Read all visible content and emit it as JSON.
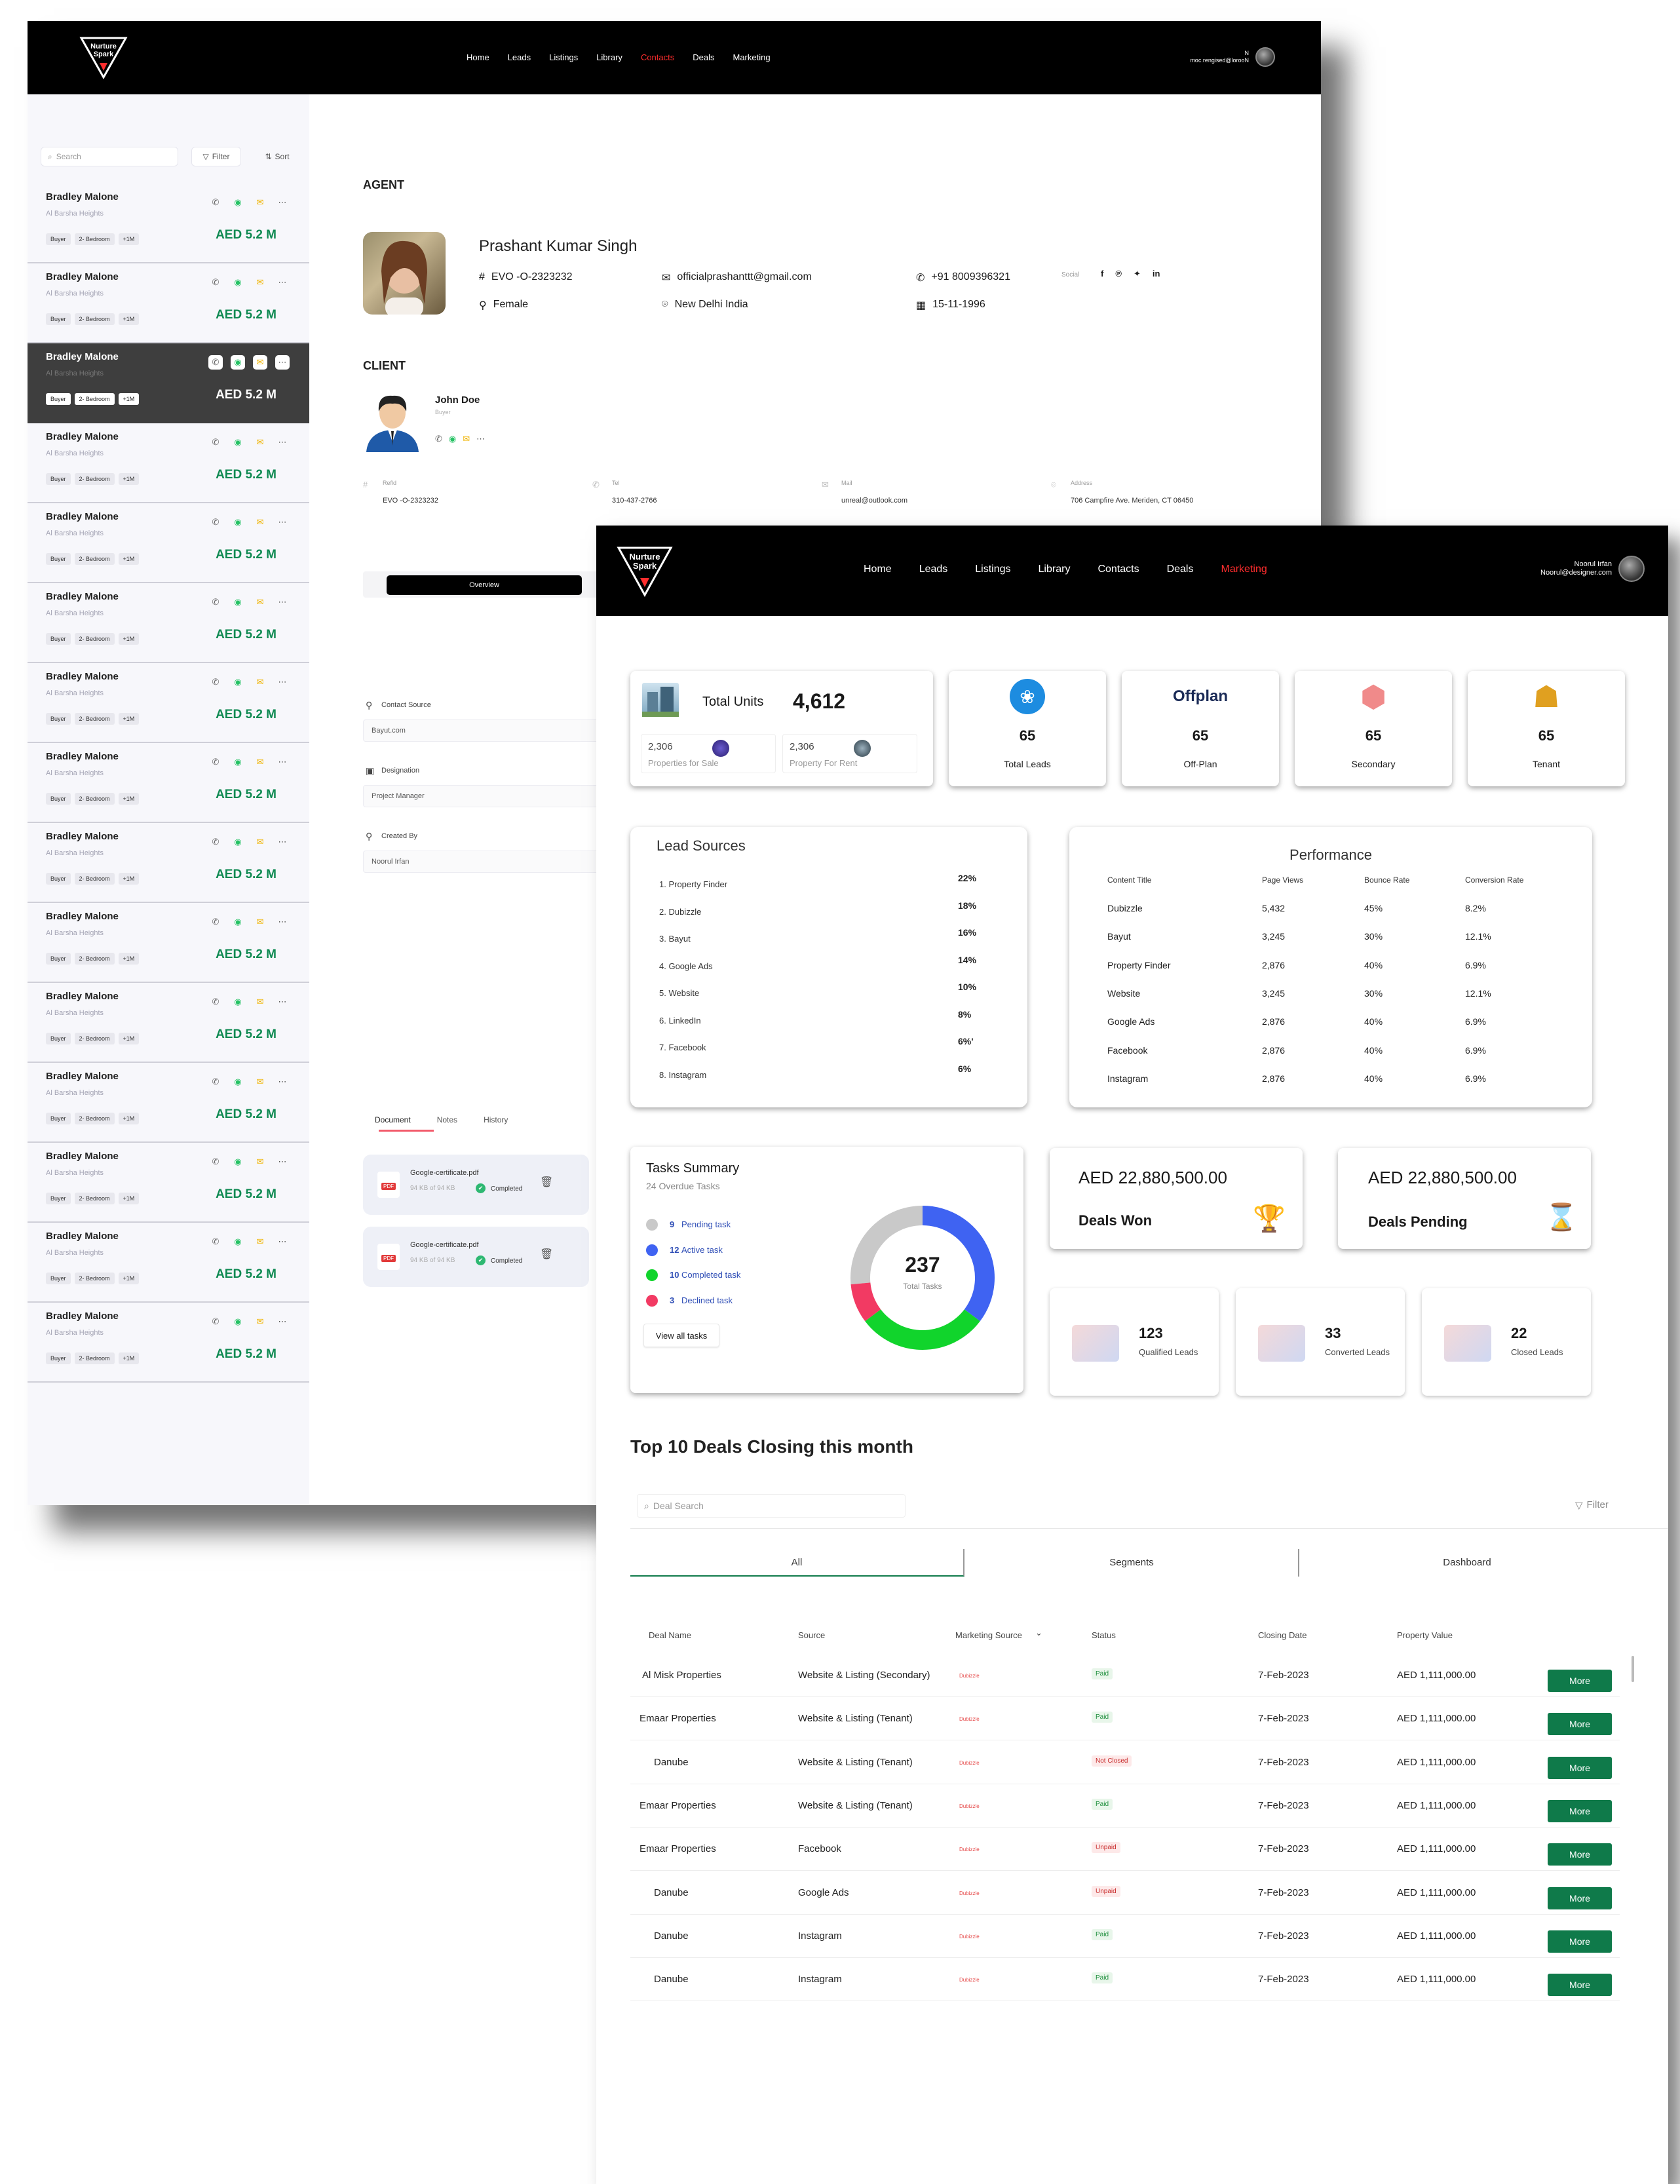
{
  "brand": {
    "name_line1": "Nurture",
    "name_line2": "Spark"
  },
  "win1": {
    "nav": [
      "Home",
      "Leads",
      "Listings",
      "Library",
      "Contacts",
      "Deals",
      "Marketing"
    ],
    "nav_active": "Contacts",
    "user": {
      "name": "N",
      "email": "moc.rengised@lorooN"
    },
    "sidebar": {
      "search_placeholder": "Search",
      "filter_label": "Filter",
      "sort_label": "Sort",
      "contacts": [
        {
          "name": "Bradley Malone",
          "location": "Al Barsha Heights",
          "tags": [
            "Buyer",
            "2- Bedroom",
            "+1M"
          ],
          "price": "AED 5.2 M"
        },
        {
          "name": "Bradley Malone",
          "location": "Al Barsha Heights",
          "tags": [
            "Buyer",
            "2- Bedroom",
            "+1M"
          ],
          "price": "AED 5.2 M"
        },
        {
          "name": "Bradley Malone",
          "location": "Al Barsha Heights",
          "tags": [
            "Buyer",
            "2- Bedroom",
            "+1M"
          ],
          "price": "AED 5.2 M"
        },
        {
          "name": "Bradley Malone",
          "location": "Al Barsha Heights",
          "tags": [
            "Buyer",
            "2- Bedroom",
            "+1M"
          ],
          "price": "AED 5.2 M"
        },
        {
          "name": "Bradley Malone",
          "location": "Al Barsha Heights",
          "tags": [
            "Buyer",
            "2- Bedroom",
            "+1M"
          ],
          "price": "AED 5.2 M"
        },
        {
          "name": "Bradley Malone",
          "location": "Al Barsha Heights",
          "tags": [
            "Buyer",
            "2- Bedroom",
            "+1M"
          ],
          "price": "AED 5.2 M"
        },
        {
          "name": "Bradley Malone",
          "location": "Al Barsha Heights",
          "tags": [
            "Buyer",
            "2- Bedroom",
            "+1M"
          ],
          "price": "AED 5.2 M"
        },
        {
          "name": "Bradley Malone",
          "location": "Al Barsha Heights",
          "tags": [
            "Buyer",
            "2- Bedroom",
            "+1M"
          ],
          "price": "AED 5.2 M"
        },
        {
          "name": "Bradley Malone",
          "location": "Al Barsha Heights",
          "tags": [
            "Buyer",
            "2- Bedroom",
            "+1M"
          ],
          "price": "AED 5.2 M"
        },
        {
          "name": "Bradley Malone",
          "location": "Al Barsha Heights",
          "tags": [
            "Buyer",
            "2- Bedroom",
            "+1M"
          ],
          "price": "AED 5.2 M"
        },
        {
          "name": "Bradley Malone",
          "location": "Al Barsha Heights",
          "tags": [
            "Buyer",
            "2- Bedroom",
            "+1M"
          ],
          "price": "AED 5.2 M"
        },
        {
          "name": "Bradley Malone",
          "location": "Al Barsha Heights",
          "tags": [
            "Buyer",
            "2- Bedroom",
            "+1M"
          ],
          "price": "AED 5.2 M"
        },
        {
          "name": "Bradley Malone",
          "location": "Al Barsha Heights",
          "tags": [
            "Buyer",
            "2- Bedroom",
            "+1M"
          ],
          "price": "AED 5.2 M"
        },
        {
          "name": "Bradley Malone",
          "location": "Al Barsha Heights",
          "tags": [
            "Buyer",
            "2- Bedroom",
            "+1M"
          ],
          "price": "AED 5.2 M"
        },
        {
          "name": "Bradley Malone",
          "location": "Al Barsha Heights",
          "tags": [
            "Buyer",
            "2- Bedroom",
            "+1M"
          ],
          "price": "AED 5.2 M"
        }
      ],
      "selected_index": 2
    },
    "agent": {
      "section_title": "AGENT",
      "name": "Prashant Kumar Singh",
      "id": "EVO -O-2323232",
      "gender": "Female",
      "email": "officialprashanttt@gmail.com",
      "location": "New Delhi India",
      "phone": "+91 8009396321",
      "dob": "15-11-1996",
      "social_label": "Social",
      "social_icons": [
        "facebook-icon",
        "pinterest-icon",
        "twitter-icon",
        "linkedin-icon"
      ]
    },
    "client": {
      "section_title": "CLIENT",
      "name": "John Doe",
      "role": "Buyer",
      "fields": [
        {
          "label": "Refld",
          "value": "EVO -O-2323232"
        },
        {
          "label": "Tel",
          "value": "310-437-2766"
        },
        {
          "label": "Mail",
          "value": "unreal@outlook.com"
        },
        {
          "label": "Address",
          "value": "706 Campfire Ave. Meriden, CT 06450"
        }
      ]
    },
    "tabs": {
      "active": "Overview"
    },
    "meta": [
      {
        "label": "Contact Source",
        "value": "Bayut.com"
      },
      {
        "label": "Designation",
        "value": "Project Manager"
      },
      {
        "label": "Created By",
        "value": "Noorul Irfan"
      }
    ],
    "doc_tabs": [
      "Document",
      "Notes",
      "History"
    ],
    "documents": [
      {
        "file": "Google-certificate.pdf",
        "size": "94 KB of 94 KB",
        "status": "Completed",
        "type": "PDF"
      },
      {
        "file": "Google-certificate.pdf",
        "size": "94 KB of 94 KB",
        "status": "Completed",
        "type": "PDF"
      }
    ]
  },
  "win2": {
    "nav": [
      "Home",
      "Leads",
      "Listings",
      "Library",
      "Contacts",
      "Deals",
      "Marketing"
    ],
    "nav_active": "Marketing",
    "user": {
      "name": "Noorul Irfan",
      "email": "Noorul@designer.com"
    },
    "total_units": {
      "label": "Total Units",
      "value": "4,612",
      "sale_value": "2,306",
      "sale_label": "Properties for Sale",
      "rent_value": "2,306",
      "rent_label": "Property For Rent"
    },
    "stats": [
      {
        "value": "65",
        "label": "Total Leads",
        "icon": "leads-icon"
      },
      {
        "value": "65",
        "label": "Off-Plan",
        "icon": "offplan-logo",
        "logo_text": "Offplan"
      },
      {
        "value": "65",
        "label": "Secondary",
        "icon": "secondary-icon"
      },
      {
        "value": "65",
        "label": "Tenant",
        "icon": "tenant-icon"
      }
    ],
    "lead_sources": {
      "title": "Lead Sources",
      "items": [
        {
          "name": "1. Property Finder",
          "pct": "22%"
        },
        {
          "name": "2. Dubizzle",
          "pct": "18%"
        },
        {
          "name": "3. Bayut",
          "pct": "16%"
        },
        {
          "name": "4. Google Ads",
          "pct": "14%"
        },
        {
          "name": "5. Website",
          "pct": "10%"
        },
        {
          "name": "6. LinkedIn",
          "pct": "8%"
        },
        {
          "name": "7. Facebook",
          "pct": "6%'"
        },
        {
          "name": "8. Instagram",
          "pct": "6%"
        }
      ]
    },
    "performance": {
      "title": "Performance",
      "headers": [
        "Content Title",
        "Page Views",
        "Bounce Rate",
        "Conversion Rate"
      ],
      "rows": [
        [
          "Dubizzle",
          "5,432",
          "45%",
          "8.2%"
        ],
        [
          "Bayut",
          "3,245",
          "30%",
          "12.1%"
        ],
        [
          "Property Finder",
          "2,876",
          "40%",
          "6.9%"
        ],
        [
          "Website",
          "3,245",
          "30%",
          "12.1%"
        ],
        [
          "Google Ads",
          "2,876",
          "40%",
          "6.9%"
        ],
        [
          "Facebook",
          "2,876",
          "40%",
          "6.9%"
        ],
        [
          "Instagram",
          "2,876",
          "40%",
          "6.9%"
        ]
      ]
    },
    "tasks": {
      "title": "Tasks Summary",
      "subtitle": "24 Overdue Tasks",
      "legend": [
        {
          "count": "9",
          "label": "Pending task",
          "color": "#c9c9c9"
        },
        {
          "count": "12",
          "label": "Active task",
          "color": "#3f63f2"
        },
        {
          "count": "10",
          "label": "Completed task",
          "color": "#11d42c"
        },
        {
          "count": "3",
          "label": "Declined task",
          "color": "#f23a63"
        }
      ],
      "view_all": "View all tasks",
      "total": "237",
      "total_label": "Total Tasks"
    },
    "chart_data": {
      "type": "pie",
      "categories": [
        "Pending task",
        "Active task",
        "Completed task",
        "Declined task"
      ],
      "values": [
        9,
        12,
        10,
        3
      ],
      "colors": [
        "#c9c9c9",
        "#3f63f2",
        "#11d42c",
        "#f23a63"
      ]
    },
    "deals_won": {
      "amount": "AED 22,880,500.00",
      "label": "Deals Won"
    },
    "deals_pending": {
      "amount": "AED 22,880,500.00",
      "label": "Deals Pending"
    },
    "leads_summary": [
      {
        "value": "123",
        "label": "Qualified Leads"
      },
      {
        "value": "33",
        "label": "Converted Leads"
      },
      {
        "value": "22",
        "label": "Closed Leads"
      }
    ],
    "deals_table": {
      "title": "Top 10 Deals Closing this month",
      "search_placeholder": "Deal Search",
      "filter_label": "Filter",
      "tabs": [
        "All",
        "Segments",
        "Dashboard"
      ],
      "headers": [
        "Deal Name",
        "Source",
        "Marketing Source",
        "Status",
        "Closing Date",
        "Property Value"
      ],
      "rows": [
        {
          "name": "Al Misk Properties",
          "source": "Website & Listing (Secondary)",
          "mkt": "Dubizzle",
          "status": "Paid",
          "date": "7-Feb-2023",
          "value": "AED 1,111,000.00"
        },
        {
          "name": "Emaar Properties",
          "source": "Website & Listing (Tenant)",
          "mkt": "Dubizzle",
          "status": "Paid",
          "date": "7-Feb-2023",
          "value": "AED 1,111,000.00"
        },
        {
          "name": "Danube",
          "source": "Website & Listing (Tenant)",
          "mkt": "Dubizzle",
          "status": "Not Closed",
          "date": "7-Feb-2023",
          "value": "AED 1,111,000.00"
        },
        {
          "name": "Emaar Properties",
          "source": "Website & Listing (Tenant)",
          "mkt": "Dubizzle",
          "status": "Paid",
          "date": "7-Feb-2023",
          "value": "AED 1,111,000.00"
        },
        {
          "name": "Emaar Properties",
          "source": "Facebook",
          "mkt": "Dubizzle",
          "status": "Unpaid",
          "date": "7-Feb-2023",
          "value": "AED 1,111,000.00"
        },
        {
          "name": "Danube",
          "source": "Google Ads",
          "mkt": "Dubizzle",
          "status": "Unpaid",
          "date": "7-Feb-2023",
          "value": "AED 1,111,000.00"
        },
        {
          "name": "Danube",
          "source": "Instagram",
          "mkt": "Dubizzle",
          "status": "Paid",
          "date": "7-Feb-2023",
          "value": "AED 1,111,000.00"
        },
        {
          "name": "Danube",
          "source": "Instagram",
          "mkt": "Dubizzle",
          "status": "Paid",
          "date": "7-Feb-2023",
          "value": "AED 1,111,000.00"
        }
      ],
      "more_label": "More"
    }
  },
  "colors": {
    "accent_red": "#ff2d2d",
    "green": "#0f7a4a",
    "price_green": "#0f8a52"
  }
}
